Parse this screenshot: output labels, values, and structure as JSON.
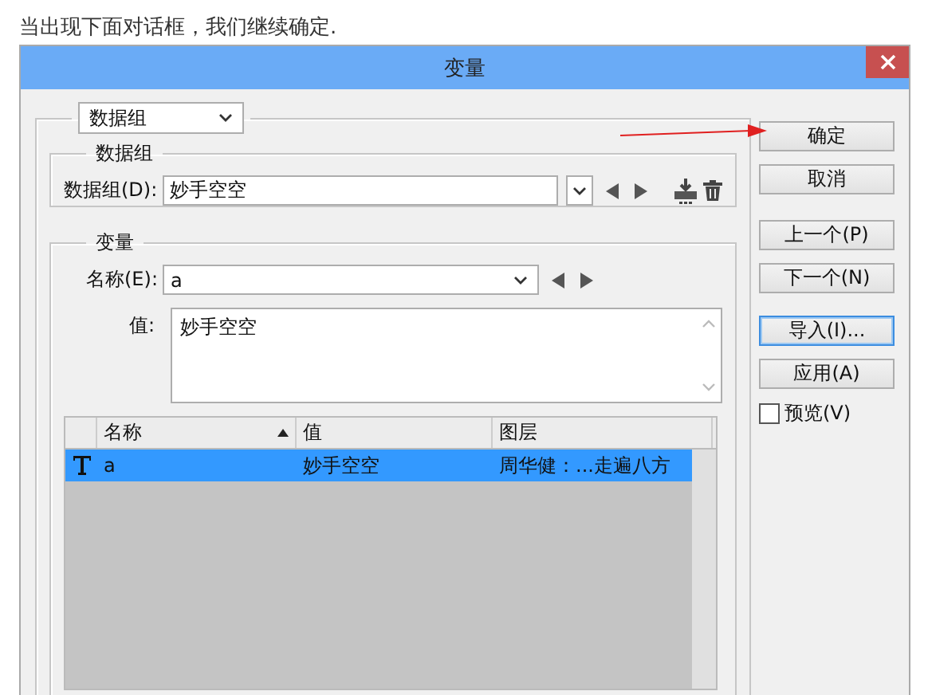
{
  "caption": "当出现下面对话框，我们继续确定.",
  "dialog": {
    "title": "变量",
    "set_dropdown": "数据组",
    "data_group": {
      "legend": "数据组",
      "label": "数据组(D):",
      "value": "妙手空空"
    },
    "variable": {
      "legend": "变量",
      "name_label": "名称(E):",
      "name_value": "a",
      "value_label": "值:",
      "value_text": "妙手空空"
    },
    "table": {
      "columns": [
        {
          "label": "名称",
          "sorted": true
        },
        {
          "label": "值",
          "sorted": false
        },
        {
          "label": "图层",
          "sorted": false
        }
      ],
      "rows": [
        {
          "kind": "text",
          "cells": [
            "a",
            "妙手空空",
            "周华健：...走遍八方"
          ],
          "selected": true
        }
      ]
    },
    "buttons": [
      {
        "label": "确定",
        "focused": false
      },
      {
        "label": "取消",
        "focused": false
      },
      {
        "label": "上一个(P)",
        "focused": false
      },
      {
        "label": "下一个(N)",
        "focused": false
      },
      {
        "label": "导入(I)...",
        "focused": true
      },
      {
        "label": "应用(A)",
        "focused": false
      }
    ],
    "preview": {
      "label": "预览(V)",
      "checked": false
    }
  }
}
